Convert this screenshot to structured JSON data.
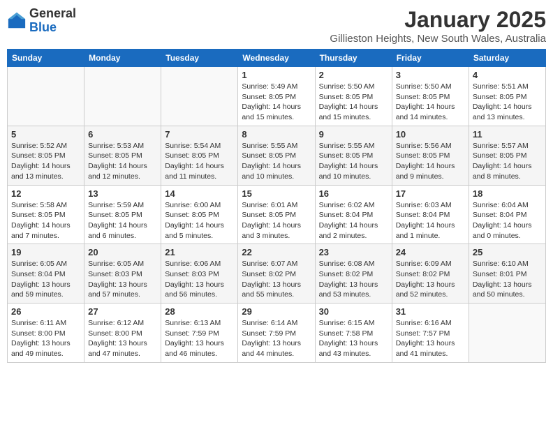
{
  "header": {
    "logo_general": "General",
    "logo_blue": "Blue",
    "month": "January 2025",
    "location": "Gillieston Heights, New South Wales, Australia"
  },
  "weekdays": [
    "Sunday",
    "Monday",
    "Tuesday",
    "Wednesday",
    "Thursday",
    "Friday",
    "Saturday"
  ],
  "weeks": [
    [
      {
        "day": "",
        "info": ""
      },
      {
        "day": "",
        "info": ""
      },
      {
        "day": "",
        "info": ""
      },
      {
        "day": "1",
        "info": "Sunrise: 5:49 AM\nSunset: 8:05 PM\nDaylight: 14 hours\nand 15 minutes."
      },
      {
        "day": "2",
        "info": "Sunrise: 5:50 AM\nSunset: 8:05 PM\nDaylight: 14 hours\nand 15 minutes."
      },
      {
        "day": "3",
        "info": "Sunrise: 5:50 AM\nSunset: 8:05 PM\nDaylight: 14 hours\nand 14 minutes."
      },
      {
        "day": "4",
        "info": "Sunrise: 5:51 AM\nSunset: 8:05 PM\nDaylight: 14 hours\nand 13 minutes."
      }
    ],
    [
      {
        "day": "5",
        "info": "Sunrise: 5:52 AM\nSunset: 8:05 PM\nDaylight: 14 hours\nand 13 minutes."
      },
      {
        "day": "6",
        "info": "Sunrise: 5:53 AM\nSunset: 8:05 PM\nDaylight: 14 hours\nand 12 minutes."
      },
      {
        "day": "7",
        "info": "Sunrise: 5:54 AM\nSunset: 8:05 PM\nDaylight: 14 hours\nand 11 minutes."
      },
      {
        "day": "8",
        "info": "Sunrise: 5:55 AM\nSunset: 8:05 PM\nDaylight: 14 hours\nand 10 minutes."
      },
      {
        "day": "9",
        "info": "Sunrise: 5:55 AM\nSunset: 8:05 PM\nDaylight: 14 hours\nand 10 minutes."
      },
      {
        "day": "10",
        "info": "Sunrise: 5:56 AM\nSunset: 8:05 PM\nDaylight: 14 hours\nand 9 minutes."
      },
      {
        "day": "11",
        "info": "Sunrise: 5:57 AM\nSunset: 8:05 PM\nDaylight: 14 hours\nand 8 minutes."
      }
    ],
    [
      {
        "day": "12",
        "info": "Sunrise: 5:58 AM\nSunset: 8:05 PM\nDaylight: 14 hours\nand 7 minutes."
      },
      {
        "day": "13",
        "info": "Sunrise: 5:59 AM\nSunset: 8:05 PM\nDaylight: 14 hours\nand 6 minutes."
      },
      {
        "day": "14",
        "info": "Sunrise: 6:00 AM\nSunset: 8:05 PM\nDaylight: 14 hours\nand 5 minutes."
      },
      {
        "day": "15",
        "info": "Sunrise: 6:01 AM\nSunset: 8:05 PM\nDaylight: 14 hours\nand 3 minutes."
      },
      {
        "day": "16",
        "info": "Sunrise: 6:02 AM\nSunset: 8:04 PM\nDaylight: 14 hours\nand 2 minutes."
      },
      {
        "day": "17",
        "info": "Sunrise: 6:03 AM\nSunset: 8:04 PM\nDaylight: 14 hours\nand 1 minute."
      },
      {
        "day": "18",
        "info": "Sunrise: 6:04 AM\nSunset: 8:04 PM\nDaylight: 14 hours\nand 0 minutes."
      }
    ],
    [
      {
        "day": "19",
        "info": "Sunrise: 6:05 AM\nSunset: 8:04 PM\nDaylight: 13 hours\nand 59 minutes."
      },
      {
        "day": "20",
        "info": "Sunrise: 6:05 AM\nSunset: 8:03 PM\nDaylight: 13 hours\nand 57 minutes."
      },
      {
        "day": "21",
        "info": "Sunrise: 6:06 AM\nSunset: 8:03 PM\nDaylight: 13 hours\nand 56 minutes."
      },
      {
        "day": "22",
        "info": "Sunrise: 6:07 AM\nSunset: 8:02 PM\nDaylight: 13 hours\nand 55 minutes."
      },
      {
        "day": "23",
        "info": "Sunrise: 6:08 AM\nSunset: 8:02 PM\nDaylight: 13 hours\nand 53 minutes."
      },
      {
        "day": "24",
        "info": "Sunrise: 6:09 AM\nSunset: 8:02 PM\nDaylight: 13 hours\nand 52 minutes."
      },
      {
        "day": "25",
        "info": "Sunrise: 6:10 AM\nSunset: 8:01 PM\nDaylight: 13 hours\nand 50 minutes."
      }
    ],
    [
      {
        "day": "26",
        "info": "Sunrise: 6:11 AM\nSunset: 8:00 PM\nDaylight: 13 hours\nand 49 minutes."
      },
      {
        "day": "27",
        "info": "Sunrise: 6:12 AM\nSunset: 8:00 PM\nDaylight: 13 hours\nand 47 minutes."
      },
      {
        "day": "28",
        "info": "Sunrise: 6:13 AM\nSunset: 7:59 PM\nDaylight: 13 hours\nand 46 minutes."
      },
      {
        "day": "29",
        "info": "Sunrise: 6:14 AM\nSunset: 7:59 PM\nDaylight: 13 hours\nand 44 minutes."
      },
      {
        "day": "30",
        "info": "Sunrise: 6:15 AM\nSunset: 7:58 PM\nDaylight: 13 hours\nand 43 minutes."
      },
      {
        "day": "31",
        "info": "Sunrise: 6:16 AM\nSunset: 7:57 PM\nDaylight: 13 hours\nand 41 minutes."
      },
      {
        "day": "",
        "info": ""
      }
    ]
  ]
}
